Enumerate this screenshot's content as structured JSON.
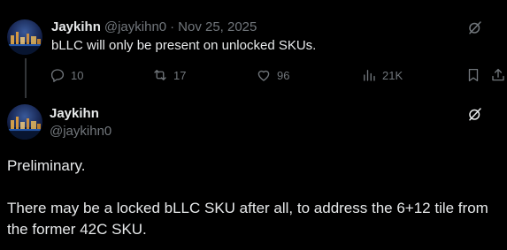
{
  "tweet1": {
    "author_name": "Jaykihn",
    "author_handle": "@jaykihn0",
    "separator": "·",
    "date": "Nov 25, 2025",
    "text": "bLLC will only be present on unlocked SKUs.",
    "stats": {
      "replies": "10",
      "reposts": "17",
      "likes": "96",
      "views": "21K"
    }
  },
  "tweet2": {
    "author_name": "Jaykihn",
    "author_handle": "@jaykihn0",
    "paragraphs": [
      "Preliminary.",
      "There may be a locked bLLC SKU after all, to address the 6+12 tile from the former 42C SKU."
    ]
  },
  "icons": {
    "reply": "reply-icon",
    "repost": "repost-icon",
    "like": "heart-icon",
    "views": "views-icon",
    "bookmark": "bookmark-icon",
    "share": "share-icon",
    "grok": "grok-icon"
  },
  "colors": {
    "background": "#000000",
    "text": "#e7e9ea",
    "muted": "#71767b",
    "thread_line": "#333639"
  }
}
